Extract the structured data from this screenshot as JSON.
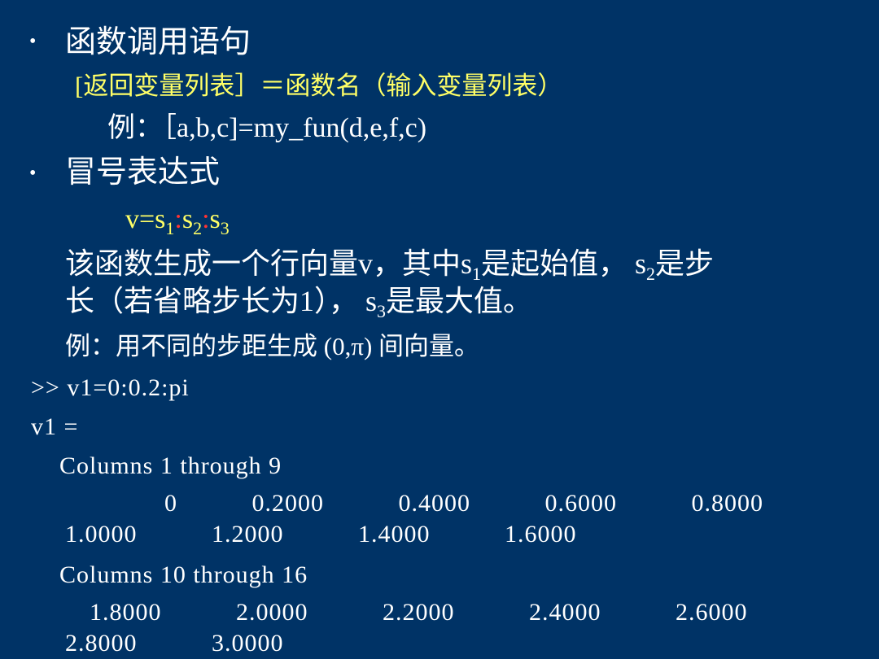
{
  "slide": {
    "background": "#003366",
    "bullets": [
      {
        "text": "函数调用语句"
      },
      {
        "text": "冒号表达式"
      }
    ],
    "signature": "[返回变量列表］＝函数名（输入变量列表）",
    "example1": "例：［a,b,c]=my_fun(d,e,f,c)",
    "formula": {
      "v": "v=s",
      "sub1": "1",
      "colon1": ":",
      "s2": "s",
      "sub2": "2",
      "colon2": ":",
      "s3": "s",
      "sub3": "3"
    },
    "description": {
      "line1_a": "该函数生成一个行向量v，其中s",
      "line1_sub1": "1",
      "line1_b": "是起始值， s",
      "line1_sub2": "2",
      "line1_c": "是步",
      "line2_a": "长（若省略步长为1）， s",
      "line2_sub3": "3",
      "line2_b": "是最大值。"
    },
    "example2": "例：用不同的步距生成 (0,π) 间向量。",
    "console": {
      "command": ">> v1=0:0.2:pi",
      "result_label": "v1 =",
      "block1_header": "Columns 1 through 9",
      "block1_row1": [
        "0",
        "0.2000",
        "0.4000",
        "0.6000",
        "0.8000"
      ],
      "block1_row2": [
        "1.0000",
        "1.2000",
        "1.4000",
        "1.6000"
      ],
      "block2_header": "Columns 10 through 16",
      "block2_row1": [
        "1.8000",
        "2.0000",
        "2.2000",
        "2.4000",
        "2.6000"
      ],
      "block2_row2": [
        "2.8000",
        "3.0000"
      ]
    }
  }
}
